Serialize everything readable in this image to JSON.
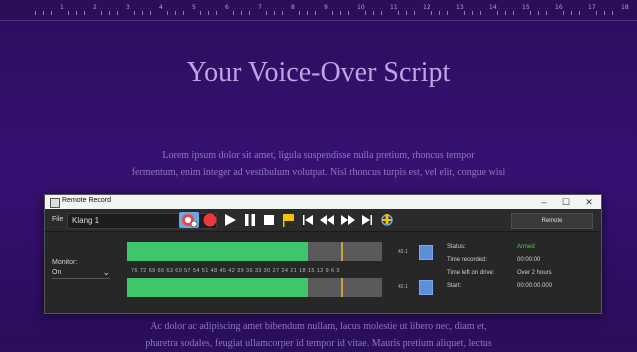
{
  "document": {
    "ruler_ticks": [
      "1",
      "2",
      "3",
      "4",
      "5",
      "6",
      "7",
      "8",
      "9",
      "10",
      "11",
      "12",
      "13",
      "14",
      "15",
      "16",
      "17",
      "18"
    ],
    "title": "Your Voice-Over Script",
    "para1_line1": "Lorem ipsum dolor sit amet, ligula suspendisse nulla pretium, rhoncus tempor",
    "para1_line2": "fermentum, enim integer ad vestibulum volutpat. Nisl rhoncus turpis est, vel elit, congue wisi",
    "para2_line1": "Ac dolor ac adipiscing amet bibendum nullam, lacus molestie ut libero nec, diam et,",
    "para2_line2": "pharetra sodales, feugiat ullamcorper id tempor id vitae. Mauris pretium aliquet, lectus"
  },
  "window": {
    "title": "Remote Record",
    "minimize": "–",
    "maximize": "☐",
    "close": "✕"
  },
  "toolbar": {
    "file_label": "File",
    "source_value": "Klang 1",
    "remote_button": "Remote"
  },
  "monitor": {
    "label": "Monitor:",
    "value": "On"
  },
  "meter": {
    "scale": "76 72 69 66 63 60 57 54 51 48 45 42 39 36 33 30 27 24 21 18 15 12 9 6 3",
    "ch1_label": "42.1",
    "ch2_label": "42.1",
    "ch1_level": 0.71,
    "ch2_level": 0.71,
    "peak_position": 0.84
  },
  "status": {
    "status_label": "Status:",
    "status_value": "Armed",
    "status_color": "#4ccf4c",
    "recorded_label": "Time recorded:",
    "recorded_value": "00:00:00",
    "left_label": "Time left on drive:",
    "left_value": "Over 2 hours",
    "start_label": "Start:",
    "start_value": "00:00:00.000"
  }
}
